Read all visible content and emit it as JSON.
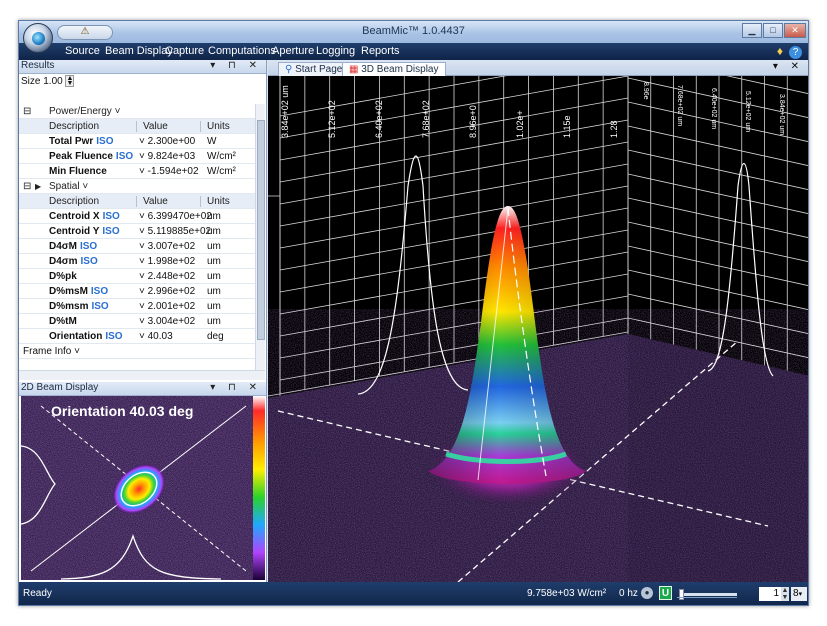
{
  "window": {
    "title": "BeamMic™ 1.0.4437"
  },
  "menu": {
    "items": [
      "Source",
      "Beam Display",
      "Capture",
      "Computations",
      "Aperture",
      "Logging",
      "Reports"
    ]
  },
  "results": {
    "panel_title": "Results",
    "size_label": "Size",
    "size_value": "1.00",
    "groups": [
      {
        "name": "Power/Energy ˅",
        "headers": [
          "Description",
          "Value",
          "Units"
        ],
        "rows": [
          {
            "desc": "Total Pwr",
            "iso": "ISO",
            "value": "2.300e+00",
            "units": "W"
          },
          {
            "desc": "Peak Fluence",
            "iso": "ISO",
            "value": "9.824e+03",
            "units": "W/cm²"
          },
          {
            "desc": "Min Fluence",
            "iso": "",
            "value": "-1.594e+02",
            "units": "W/cm²"
          }
        ]
      },
      {
        "name": "Spatial ˅",
        "headers": [
          "Description",
          "Value",
          "Units"
        ],
        "rows": [
          {
            "desc": "Centroid X",
            "iso": "ISO",
            "value": "6.399470e+02",
            "units": "um"
          },
          {
            "desc": "Centroid Y",
            "iso": "ISO",
            "value": "5.119885e+02",
            "units": "um"
          },
          {
            "desc": "D4σM",
            "iso": "ISO",
            "value": "3.007e+02",
            "units": "um"
          },
          {
            "desc": "D4σm",
            "iso": "ISO",
            "value": "1.998e+02",
            "units": "um"
          },
          {
            "desc": "D%pk",
            "iso": "",
            "value": "2.448e+02",
            "units": "um"
          },
          {
            "desc": "D%msM",
            "iso": "ISO",
            "value": "2.996e+02",
            "units": "um"
          },
          {
            "desc": "D%msm",
            "iso": "ISO",
            "value": "2.001e+02",
            "units": "um"
          },
          {
            "desc": "D%tM",
            "iso": "",
            "value": "3.004e+02",
            "units": "um"
          },
          {
            "desc": "Orientation",
            "iso": "ISO",
            "value": "40.03",
            "units": "deg"
          }
        ]
      }
    ],
    "frame_info": "Frame Info ˅"
  },
  "beam2d": {
    "panel_title": "2D Beam Display",
    "overlay": "Orientation 40.03 deg"
  },
  "tabs": [
    {
      "label": "Start Page"
    },
    {
      "label": "3D Beam Display"
    }
  ],
  "axis_labels_back": [
    "3.84e+02 um",
    "5.12e+02",
    "6.40e+02",
    "7.68e+02",
    "8.96e+0",
    "1.02e+",
    "1.15e",
    "1.28"
  ],
  "axis_labels_side": [
    "8.96e",
    "7.68e+02 um",
    "6.40e+02 um",
    "5.12e+02 um",
    "3.84e+02 um"
  ],
  "status": {
    "text": "Ready",
    "fluence": "9.758e+03 W/cm²",
    "rate": "0 hz",
    "u_label": "U",
    "frame_num": "1",
    "select": "8"
  },
  "colors": {
    "frame": "#0f2447",
    "accent": "#2a6fd0",
    "floor": "#2a1a3d"
  }
}
